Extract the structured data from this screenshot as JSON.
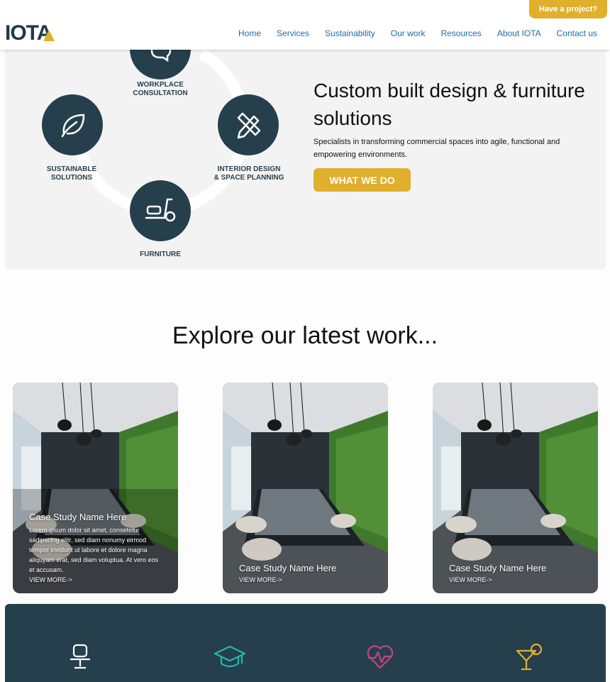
{
  "header": {
    "logo_text": "IOTA",
    "cta_label": "Have a project?",
    "nav": [
      "Home",
      "Services",
      "Sustainability",
      "Our work",
      "Resources",
      "About IOTA",
      "Contact us"
    ]
  },
  "hero": {
    "title": "Custom built design & furniture solutions",
    "subtitle": "Specialists in transforming commercial spaces into agile, functional and empowering environments.",
    "button_label": "WHAT WE DO",
    "services": {
      "workplace": "WORKPLACE\nCONSULTATION",
      "sustainable": "SUSTAINABLE\nSOLUTIONS",
      "interior": "INTERIOR DESIGN\n& SPACE PLANNING",
      "furniture": "FURNITURE"
    }
  },
  "work": {
    "title": "Explore our latest work...",
    "cards": [
      {
        "title": "Case Study Name Here",
        "body": "Lorem ipsum dolor sit amet, consetetur sadipscing elitr, sed diam nonumy eirmod tempor invidunt ut labore et dolore magna aliquyam erat, sed diam voluptua. At vero eos et accusam.",
        "more": "VIEW MORE->"
      },
      {
        "title": "Case Study Name Here",
        "more": "VIEW MORE->"
      },
      {
        "title": "Case Study Name Here",
        "more": "VIEW MORE->"
      }
    ]
  },
  "sectors": {
    "icons": [
      "office-chair-icon",
      "graduation-cap-icon",
      "heart-pulse-icon",
      "cocktail-icon"
    ],
    "colors": [
      "#ffffff",
      "#22b8b0",
      "#c2457e",
      "#e0b02c"
    ]
  },
  "colors": {
    "accent": "#e0b02c",
    "navy": "#263f4d",
    "nav_link": "#1d6ca6"
  }
}
